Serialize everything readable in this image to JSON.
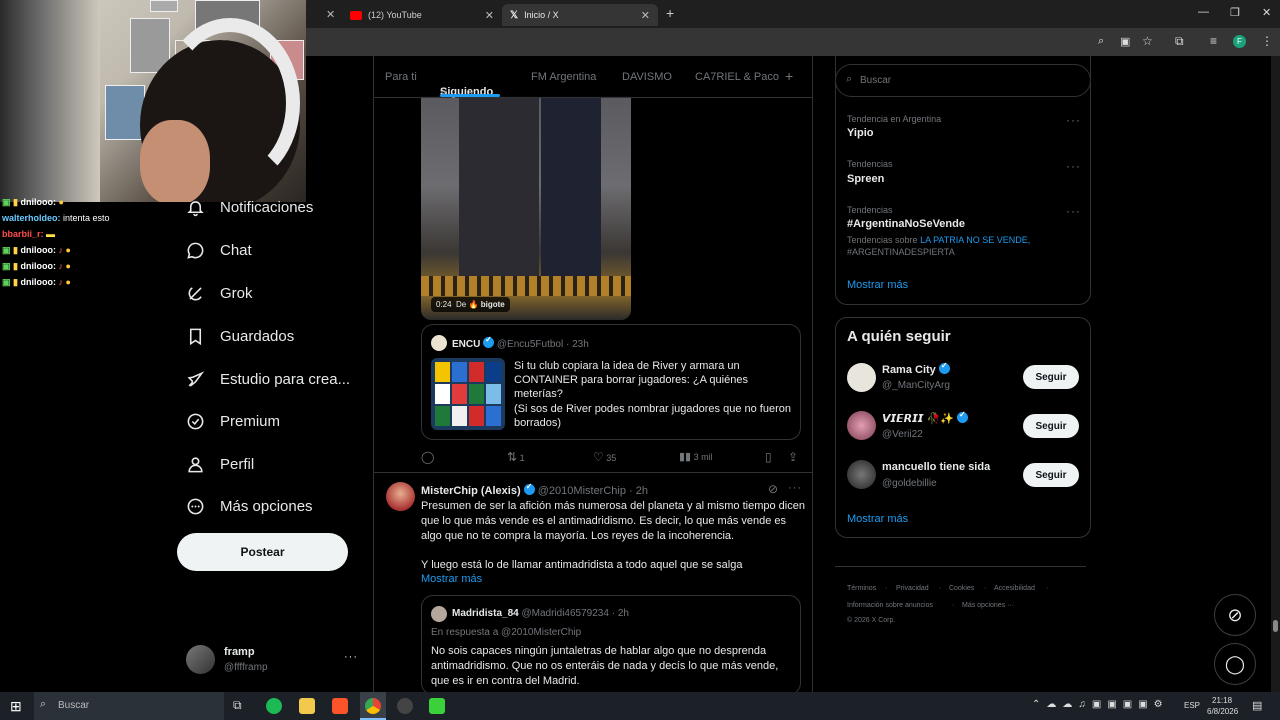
{
  "browser": {
    "tabs": [
      {
        "label": "(12) YouTube"
      },
      {
        "label": "Inicio / X"
      }
    ],
    "new_tab": "+",
    "profile_initial": "F"
  },
  "stream_chat": [
    {
      "user": "dnilooo:",
      "text": ""
    },
    {
      "user": "walterholdeo:",
      "text": "intenta esto"
    },
    {
      "user": "bbarbii_r:",
      "text": ""
    },
    {
      "user": "dnilooo:",
      "text": ""
    },
    {
      "user": "dnilooo:",
      "text": ""
    },
    {
      "user": "dnilooo:",
      "text": ""
    }
  ],
  "sidebar": {
    "items": [
      {
        "label": "Notificaciones",
        "icon": "bell-icon"
      },
      {
        "label": "Chat",
        "icon": "chat-icon"
      },
      {
        "label": "Grok",
        "icon": "grok-icon"
      },
      {
        "label": "Guardados",
        "icon": "bookmark-icon"
      },
      {
        "label": "Estudio para crea...",
        "icon": "rocket-icon"
      },
      {
        "label": "Premium",
        "icon": "premium-icon"
      },
      {
        "label": "Perfil",
        "icon": "profile-icon"
      },
      {
        "label": "Más opciones",
        "icon": "more-circle-icon"
      }
    ],
    "post_button": "Postear",
    "account": {
      "name": "framp",
      "handle": "@fffframp"
    }
  },
  "timeline": {
    "tabs": [
      "Para ti",
      "Siguiendo",
      "FM Argentina",
      "DAVISMO",
      "CA7RIEL & Paco"
    ],
    "active_tab": "Siguiendo",
    "video_time": "0:24",
    "video_from": "De",
    "video_source": "bigote",
    "quote1": {
      "name": "ENCU",
      "handle": "@Encu5Futbol",
      "sep": "·",
      "time": "23h",
      "text1": "Si tu club copiara la idea de River y armara un CONTAINER para borrar jugadores: ¿A quiénes meterías?",
      "text2": "(Si sos de River podes nombrar jugadores que no fueron borrados)"
    },
    "actions1": {
      "retweets": "1",
      "likes": "35",
      "views": "3 mil"
    },
    "post2": {
      "name": "MisterChip (Alexis)",
      "handle": "@2010MisterChip",
      "sep": "·",
      "time": "2h",
      "text1": "Presumen de ser la afición más numerosa del planeta y al mismo tiempo dicen que lo que más vende es el antimadridismo. Es decir, lo que más vende es algo que no te compra la mayoría. Los reyes de la incoherencia.",
      "text2": "Y luego está lo de llamar antimadridista a todo aquel que se salga",
      "show_more": "Mostrar más"
    },
    "quote2": {
      "name": "Madridista_84",
      "handle": "@Madridi46579234",
      "sep": "·",
      "time": "2h",
      "reply_to": "En respuesta a @2010MisterChip",
      "text": "No sois capaces ningún juntaletras de hablar algo que no desprenda antimadridismo. Que no os enteráis de nada y decís lo que más vende, que es ir en contra del Madrid."
    }
  },
  "right": {
    "search_placeholder": "Buscar",
    "trends": [
      {
        "context": "Tendencia en Argentina",
        "name": "Yipio"
      },
      {
        "context": "Tendencias",
        "name": "Spreen"
      },
      {
        "context": "Tendencias",
        "name": "#ArgentinaNoSeVende",
        "about_label": "Tendencias sobre",
        "about": "LA PATRIA NO SE VENDE,",
        "about2": "#ARGENTINADESPIERTA"
      }
    ],
    "trends_more": "Mostrar más",
    "who_to_follow_title": "A quién seguir",
    "follow": [
      {
        "name": "Rama City",
        "handle": "@_ManCityArg",
        "button": "Seguir"
      },
      {
        "name": "𝙑𝙄𝙀𝙍𝙄𝙄 🥀✨",
        "handle": "@Verii22",
        "button": "Seguir"
      },
      {
        "name": "mancuello tiene sida",
        "handle": "@goldebillie",
        "button": "Seguir"
      }
    ],
    "follow_more": "Mostrar más",
    "footer": {
      "links": [
        "Términos",
        "Privacidad",
        "Cookies",
        "Accesibilidad",
        "Información sobre anuncios",
        "Más opciones ···"
      ],
      "copyright": "© 2026 X Corp."
    }
  },
  "taskbar": {
    "search": "Buscar",
    "lang": "ESP",
    "time": "21:18",
    "date": "6/8/2026"
  }
}
